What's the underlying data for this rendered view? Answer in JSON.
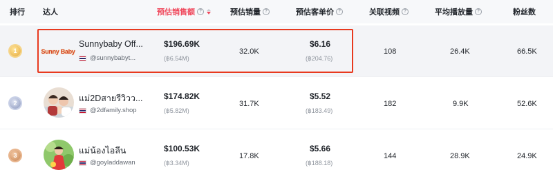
{
  "header": {
    "rank": "排行",
    "creator": "达人",
    "revenue": "预估销售额",
    "sales": "预估销量",
    "unit_price": "预估客单价",
    "videos": "关联视频",
    "avg_views": "平均播放量",
    "followers": "粉丝数",
    "help_glyph": "?"
  },
  "colors": {
    "accent": "#f0475b",
    "highlight": "#e8391e"
  },
  "rows": [
    {
      "rank": "1",
      "name": "Sunnybaby Off...",
      "handle": "@sunnybabyt...",
      "logo_text": "Sunny Baby",
      "revenue": "$196.69K",
      "revenue_local": "(฿6.54M)",
      "sales": "32.0K",
      "unit_price": "$6.16",
      "unit_price_local": "(฿204.76)",
      "videos": "108",
      "avg_views": "26.4K",
      "followers": "66.5K"
    },
    {
      "rank": "2",
      "name": "แม่2Dสายรีวิวว...",
      "handle": "@2dfamily.shop",
      "revenue": "$174.82K",
      "revenue_local": "(฿5.82M)",
      "sales": "31.7K",
      "unit_price": "$5.52",
      "unit_price_local": "(฿183.49)",
      "videos": "182",
      "avg_views": "9.9K",
      "followers": "52.6K"
    },
    {
      "rank": "3",
      "name": "แม่น้องไอลีน",
      "handle": "@goyladdawan",
      "revenue": "$100.53K",
      "revenue_local": "(฿3.34M)",
      "sales": "17.8K",
      "unit_price": "$5.66",
      "unit_price_local": "(฿188.18)",
      "videos": "144",
      "avg_views": "28.9K",
      "followers": "24.9K"
    }
  ]
}
